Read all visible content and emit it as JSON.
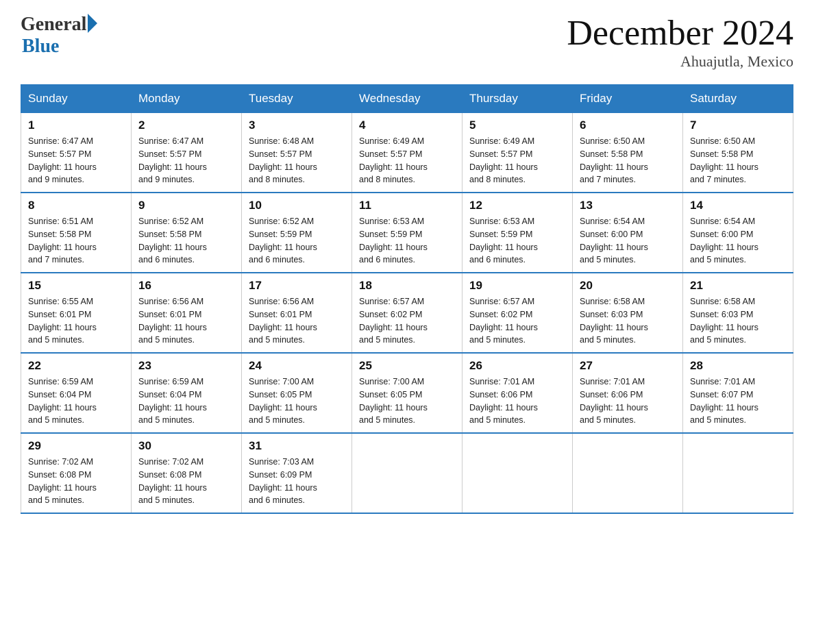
{
  "logo": {
    "general": "General",
    "blue": "Blue"
  },
  "title": "December 2024",
  "subtitle": "Ahuajutla, Mexico",
  "days_of_week": [
    "Sunday",
    "Monday",
    "Tuesday",
    "Wednesday",
    "Thursday",
    "Friday",
    "Saturday"
  ],
  "weeks": [
    [
      {
        "num": "1",
        "sunrise": "6:47 AM",
        "sunset": "5:57 PM",
        "daylight": "11 hours and 9 minutes."
      },
      {
        "num": "2",
        "sunrise": "6:47 AM",
        "sunset": "5:57 PM",
        "daylight": "11 hours and 9 minutes."
      },
      {
        "num": "3",
        "sunrise": "6:48 AM",
        "sunset": "5:57 PM",
        "daylight": "11 hours and 8 minutes."
      },
      {
        "num": "4",
        "sunrise": "6:49 AM",
        "sunset": "5:57 PM",
        "daylight": "11 hours and 8 minutes."
      },
      {
        "num": "5",
        "sunrise": "6:49 AM",
        "sunset": "5:57 PM",
        "daylight": "11 hours and 8 minutes."
      },
      {
        "num": "6",
        "sunrise": "6:50 AM",
        "sunset": "5:58 PM",
        "daylight": "11 hours and 7 minutes."
      },
      {
        "num": "7",
        "sunrise": "6:50 AM",
        "sunset": "5:58 PM",
        "daylight": "11 hours and 7 minutes."
      }
    ],
    [
      {
        "num": "8",
        "sunrise": "6:51 AM",
        "sunset": "5:58 PM",
        "daylight": "11 hours and 7 minutes."
      },
      {
        "num": "9",
        "sunrise": "6:52 AM",
        "sunset": "5:58 PM",
        "daylight": "11 hours and 6 minutes."
      },
      {
        "num": "10",
        "sunrise": "6:52 AM",
        "sunset": "5:59 PM",
        "daylight": "11 hours and 6 minutes."
      },
      {
        "num": "11",
        "sunrise": "6:53 AM",
        "sunset": "5:59 PM",
        "daylight": "11 hours and 6 minutes."
      },
      {
        "num": "12",
        "sunrise": "6:53 AM",
        "sunset": "5:59 PM",
        "daylight": "11 hours and 6 minutes."
      },
      {
        "num": "13",
        "sunrise": "6:54 AM",
        "sunset": "6:00 PM",
        "daylight": "11 hours and 5 minutes."
      },
      {
        "num": "14",
        "sunrise": "6:54 AM",
        "sunset": "6:00 PM",
        "daylight": "11 hours and 5 minutes."
      }
    ],
    [
      {
        "num": "15",
        "sunrise": "6:55 AM",
        "sunset": "6:01 PM",
        "daylight": "11 hours and 5 minutes."
      },
      {
        "num": "16",
        "sunrise": "6:56 AM",
        "sunset": "6:01 PM",
        "daylight": "11 hours and 5 minutes."
      },
      {
        "num": "17",
        "sunrise": "6:56 AM",
        "sunset": "6:01 PM",
        "daylight": "11 hours and 5 minutes."
      },
      {
        "num": "18",
        "sunrise": "6:57 AM",
        "sunset": "6:02 PM",
        "daylight": "11 hours and 5 minutes."
      },
      {
        "num": "19",
        "sunrise": "6:57 AM",
        "sunset": "6:02 PM",
        "daylight": "11 hours and 5 minutes."
      },
      {
        "num": "20",
        "sunrise": "6:58 AM",
        "sunset": "6:03 PM",
        "daylight": "11 hours and 5 minutes."
      },
      {
        "num": "21",
        "sunrise": "6:58 AM",
        "sunset": "6:03 PM",
        "daylight": "11 hours and 5 minutes."
      }
    ],
    [
      {
        "num": "22",
        "sunrise": "6:59 AM",
        "sunset": "6:04 PM",
        "daylight": "11 hours and 5 minutes."
      },
      {
        "num": "23",
        "sunrise": "6:59 AM",
        "sunset": "6:04 PM",
        "daylight": "11 hours and 5 minutes."
      },
      {
        "num": "24",
        "sunrise": "7:00 AM",
        "sunset": "6:05 PM",
        "daylight": "11 hours and 5 minutes."
      },
      {
        "num": "25",
        "sunrise": "7:00 AM",
        "sunset": "6:05 PM",
        "daylight": "11 hours and 5 minutes."
      },
      {
        "num": "26",
        "sunrise": "7:01 AM",
        "sunset": "6:06 PM",
        "daylight": "11 hours and 5 minutes."
      },
      {
        "num": "27",
        "sunrise": "7:01 AM",
        "sunset": "6:06 PM",
        "daylight": "11 hours and 5 minutes."
      },
      {
        "num": "28",
        "sunrise": "7:01 AM",
        "sunset": "6:07 PM",
        "daylight": "11 hours and 5 minutes."
      }
    ],
    [
      {
        "num": "29",
        "sunrise": "7:02 AM",
        "sunset": "6:08 PM",
        "daylight": "11 hours and 5 minutes."
      },
      {
        "num": "30",
        "sunrise": "7:02 AM",
        "sunset": "6:08 PM",
        "daylight": "11 hours and 5 minutes."
      },
      {
        "num": "31",
        "sunrise": "7:03 AM",
        "sunset": "6:09 PM",
        "daylight": "11 hours and 6 minutes."
      },
      null,
      null,
      null,
      null
    ]
  ],
  "labels": {
    "sunrise": "Sunrise:",
    "sunset": "Sunset:",
    "daylight": "Daylight:"
  }
}
